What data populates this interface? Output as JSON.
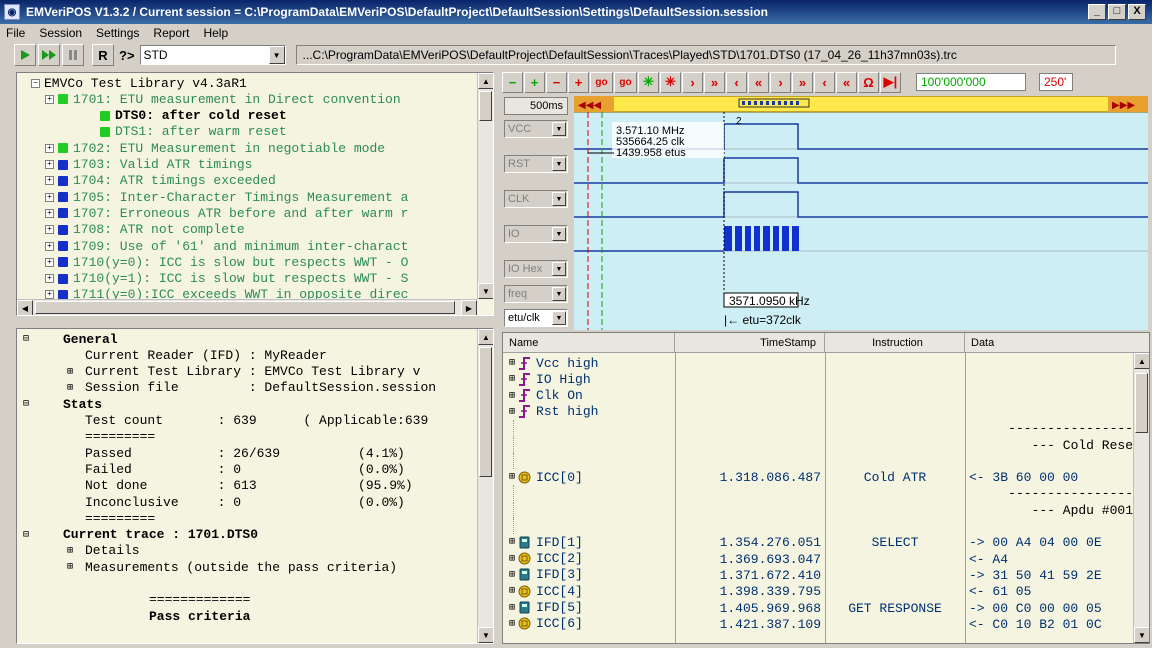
{
  "window": {
    "title": "EMVeriPOS V1.3.2 / Current session = C:\\ProgramData\\EMVeriPOS\\DefaultProject\\DefaultSession\\Settings\\DefaultSession.session",
    "min": "_",
    "max": "□",
    "close": "X"
  },
  "menu": [
    "File",
    "Session",
    "Settings",
    "Report",
    "Help"
  ],
  "toolbar": {
    "r_label": "R",
    "q_label": "?>",
    "combo_value": "STD",
    "path": "...C:\\ProgramData\\EMVeriPOS\\DefaultProject\\DefaultSession\\Traces\\Played\\STD\\1701.DTS0 (17_04_26_11h37mn03s).trc"
  },
  "tree": [
    {
      "text": "EMVCo Test Library v4.3aR1",
      "color": "#000",
      "indent": 30,
      "icon": "",
      "exp": "—"
    },
    {
      "text": "1701: ETU measurement in Direct convention",
      "color": "#2e8b57",
      "indent": 44,
      "icon": "green",
      "exp": "+"
    },
    {
      "text": "DTS0: after cold  reset",
      "color": "#000",
      "indent": 86,
      "icon": "green",
      "exp": "",
      "bold": true
    },
    {
      "text": "DTS1: after warm  reset",
      "color": "#2e8b57",
      "indent": 86,
      "icon": "green",
      "exp": ""
    },
    {
      "text": "1702: ETU Measurement in negotiable mode",
      "color": "#2e8b57",
      "indent": 44,
      "icon": "green",
      "exp": "+"
    },
    {
      "text": "1703: Valid ATR timings",
      "color": "#2e8b57",
      "indent": 44,
      "icon": "blue",
      "exp": "+"
    },
    {
      "text": "1704: ATR timings exceeded",
      "color": "#2e8b57",
      "indent": 44,
      "icon": "blue",
      "exp": "+"
    },
    {
      "text": "1705: Inter-Character Timings Measurement a",
      "color": "#2e8b57",
      "indent": 44,
      "icon": "blue",
      "exp": "+"
    },
    {
      "text": "1707: Erroneous ATR before and after warm r",
      "color": "#2e8b57",
      "indent": 44,
      "icon": "blue",
      "exp": "+"
    },
    {
      "text": "1708: ATR not complete",
      "color": "#2e8b57",
      "indent": 44,
      "icon": "blue",
      "exp": "+"
    },
    {
      "text": "1709: Use of '61' and minimum inter-charact",
      "color": "#2e8b57",
      "indent": 44,
      "icon": "blue",
      "exp": "+"
    },
    {
      "text": "1710(y=0): ICC is slow but respects WWT - O",
      "color": "#2e8b57",
      "indent": 44,
      "icon": "blue",
      "exp": "+"
    },
    {
      "text": "1710(y=1): ICC is slow but respects WWT - S",
      "color": "#2e8b57",
      "indent": 44,
      "icon": "blue",
      "exp": "+"
    },
    {
      "text": "1711(y=0):ICC exceeds WWT in opposite direc",
      "color": "#2e8b57",
      "indent": 44,
      "icon": "blue",
      "exp": "+"
    }
  ],
  "stats": [
    {
      "text": "General",
      "indent": 62,
      "bold": true,
      "exp": "—"
    },
    {
      "text": "Current Reader (IFD) : MyReader",
      "indent": 84,
      "exp": ""
    },
    {
      "text": "Current Test Library : EMVCo Test Library v",
      "indent": 84,
      "exp": "+"
    },
    {
      "text": "Session file         : DefaultSession.session",
      "indent": 84,
      "exp": "+"
    },
    {
      "text": "Stats",
      "indent": 62,
      "bold": true,
      "exp": "—"
    },
    {
      "text": "Test count       : 639      ( Applicable:639",
      "indent": 84,
      "exp": ""
    },
    {
      "text": "=========",
      "indent": 84,
      "exp": ""
    },
    {
      "text": "Passed           : 26/639          (4.1%)",
      "indent": 84,
      "exp": ""
    },
    {
      "text": "Failed           : 0               (0.0%)",
      "indent": 84,
      "exp": ""
    },
    {
      "text": "Not done         : 613             (95.9%)",
      "indent": 84,
      "exp": ""
    },
    {
      "text": "Inconclusive     : 0               (0.0%)",
      "indent": 84,
      "exp": ""
    },
    {
      "text": "=========",
      "indent": 84,
      "exp": ""
    },
    {
      "text": "Current trace : 1701.DTS0",
      "indent": 62,
      "bold": true,
      "exp": "—"
    },
    {
      "text": "Details",
      "indent": 84,
      "exp": "+"
    },
    {
      "text": "Measurements (outside the pass criteria)",
      "indent": 84,
      "exp": "+"
    },
    {
      "text": "",
      "indent": 84,
      "exp": ""
    },
    {
      "text": "=============",
      "indent": 148,
      "exp": ""
    },
    {
      "text": "Pass criteria",
      "indent": 148,
      "bold": true,
      "exp": ""
    }
  ],
  "wave": {
    "tools": [
      "−",
      "+",
      "−",
      "+",
      "go",
      "go",
      "✳",
      "✳",
      "›",
      "»",
      "‹",
      "«",
      "›",
      "»",
      "‹",
      "«",
      "Ω",
      "▶|"
    ],
    "counter": "100'000'000",
    "counter2": "250'",
    "zoom": "500ms",
    "signals": [
      "VCC",
      "RST",
      "CLK",
      "IO",
      "IO Hex",
      "freq",
      "etu/clk"
    ],
    "cursor_label": "2",
    "measure": [
      "3.571.10 MHz",
      "535664.25 clk",
      "1439.958 etus"
    ],
    "freq_label": "3571.0950 kHz",
    "etu_label": "etu=372clk"
  },
  "trace": {
    "columns": [
      "Name",
      "TimeStamp",
      "Instruction",
      "Data"
    ],
    "rows": [
      {
        "name": "Vcc high",
        "ts": "",
        "ins": "",
        "data": "",
        "icon": "edge"
      },
      {
        "name": "IO High",
        "ts": "",
        "ins": "",
        "data": "",
        "icon": "edge"
      },
      {
        "name": "Clk On",
        "ts": "",
        "ins": "",
        "data": "",
        "icon": "edge"
      },
      {
        "name": "Rst high",
        "ts": "",
        "ins": "",
        "data": "",
        "icon": "edge"
      },
      {
        "name": "",
        "ts": "",
        "ins": "",
        "data": "----------------",
        "icon": ""
      },
      {
        "name": "",
        "ts": "",
        "ins": "",
        "data": "--- Cold Rese",
        "icon": ""
      },
      {
        "name": "",
        "ts": "",
        "ins": "",
        "data": "",
        "icon": ""
      },
      {
        "name": "ICC[0]",
        "ts": "1.318.086.487",
        "ins": "Cold ATR",
        "data": "<- 3B 60 00 00",
        "icon": "icc"
      },
      {
        "name": "",
        "ts": "",
        "ins": "",
        "data": "----------------",
        "icon": ""
      },
      {
        "name": "",
        "ts": "",
        "ins": "",
        "data": "--- Apdu #001",
        "icon": ""
      },
      {
        "name": "",
        "ts": "",
        "ins": "",
        "data": "",
        "icon": ""
      },
      {
        "name": "IFD[1]",
        "ts": "1.354.276.051",
        "ins": "SELECT",
        "data": "-> 00 A4 04 00 0E",
        "icon": "ifd"
      },
      {
        "name": "ICC[2]",
        "ts": "1.369.693.047",
        "ins": "",
        "data": "<- A4",
        "icon": "icc"
      },
      {
        "name": "IFD[3]",
        "ts": "1.371.672.410",
        "ins": "",
        "data": "-> 31 50 41 59 2E",
        "icon": "ifd"
      },
      {
        "name": "ICC[4]",
        "ts": "1.398.339.795",
        "ins": "",
        "data": "<- 61 05",
        "icon": "icc"
      },
      {
        "name": "IFD[5]",
        "ts": "1.405.969.968",
        "ins": "GET RESPONSE",
        "data": "-> 00 C0 00 00 05",
        "icon": "ifd"
      },
      {
        "name": "ICC[6]",
        "ts": "1.421.387.109",
        "ins": "",
        "data": "<- C0 10 B2 01 0C",
        "icon": "icc"
      }
    ]
  },
  "colors": {
    "title_bg": "#0a246a",
    "panel_bg": "#f4f4e0",
    "wave_bg": "#cdeef5",
    "wave_line": "#1a3aa0",
    "ruler": "#ffe84a"
  }
}
